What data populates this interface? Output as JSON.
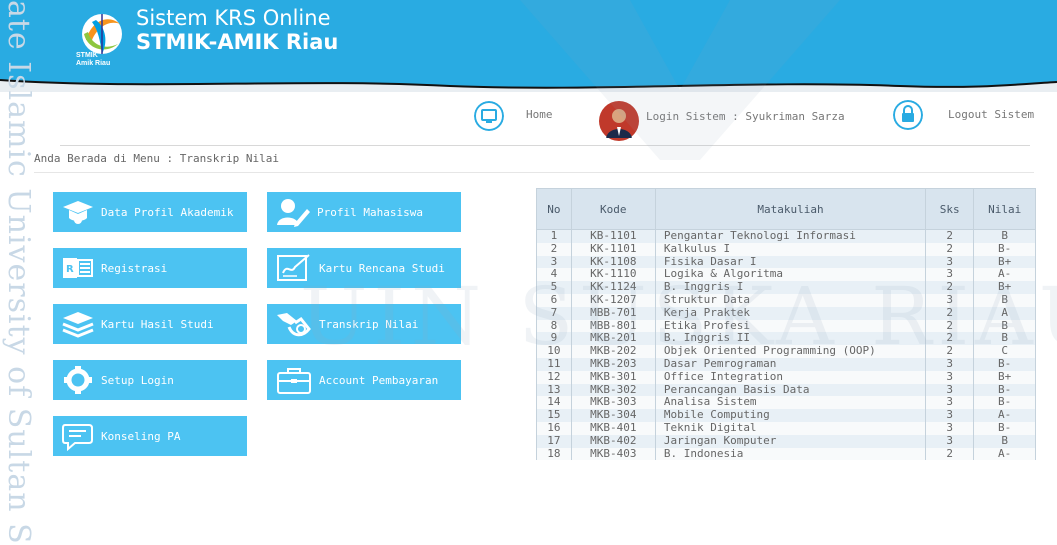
{
  "header": {
    "title_line1": "Sistem KRS Online",
    "title_line2": "STMIK-AMIK Riau",
    "logo_caption_line1": "STMIK",
    "logo_caption_line2": "Amik Riau"
  },
  "nav": {
    "home_label": "Home",
    "login_label": "Login Sistem : Syukriman Sarza",
    "logout_label": "Logout Sistem"
  },
  "breadcrumb": "Anda Berada di Menu : Transkrip Nilai",
  "menu": {
    "data_profil_akademik": "Data Profil Akademik",
    "profil_mahasiswa": "Profil Mahasiswa",
    "registrasi": "Registrasi",
    "kartu_rencana_studi": "Kartu Rencana Studi",
    "kartu_hasil_studi": "Kartu Hasil Studi",
    "transkrip_nilai": "Transkrip Nilai",
    "setup_login": "Setup Login",
    "account_pembayaran": "Account Pembayaran",
    "konseling_pa": "Konseling PA"
  },
  "table": {
    "headers": [
      "No",
      "Kode",
      "Matakuliah",
      "Sks",
      "Nilai"
    ],
    "rows": [
      [
        "1",
        "KB-1101",
        "Pengantar Teknologi Informasi",
        "2",
        "B"
      ],
      [
        "2",
        "KK-1101",
        "Kalkulus I",
        "2",
        "B-"
      ],
      [
        "3",
        "KK-1108",
        "Fisika Dasar I",
        "3",
        "B+"
      ],
      [
        "4",
        "KK-1110",
        "Logika & Algoritma",
        "3",
        "A-"
      ],
      [
        "5",
        "KK-1124",
        "B. Inggris I",
        "2",
        "B+"
      ],
      [
        "6",
        "KK-1207",
        "Struktur Data",
        "3",
        "B"
      ],
      [
        "7",
        "MBB-701",
        "Kerja Praktek",
        "2",
        "A"
      ],
      [
        "8",
        "MBB-801",
        "Etika Profesi",
        "2",
        "B"
      ],
      [
        "9",
        "MKB-201",
        "B. Inggris II",
        "2",
        "B"
      ],
      [
        "10",
        "MKB-202",
        "Objek Oriented Programming (OOP)",
        "2",
        "C"
      ],
      [
        "11",
        "MKB-203",
        "Dasar Pemrograman",
        "3",
        "B-"
      ],
      [
        "12",
        "MKB-301",
        "Office Integration",
        "3",
        "B+"
      ],
      [
        "13",
        "MKB-302",
        "Perancangan Basis Data",
        "3",
        "B-"
      ],
      [
        "14",
        "MKB-303",
        "Analisa Sistem",
        "3",
        "B-"
      ],
      [
        "15",
        "MKB-304",
        "Mobile Computing",
        "3",
        "A-"
      ],
      [
        "16",
        "MKB-401",
        "Teknik Digital",
        "3",
        "B-"
      ],
      [
        "17",
        "MKB-402",
        "Jaringan Komputer",
        "3",
        "B"
      ],
      [
        "18",
        "MKB-403",
        "B. Indonesia",
        "2",
        "A-"
      ]
    ]
  },
  "watermark": {
    "vertical": "ate Islamic University of Sultan S",
    "center": "UIN SUSKA RIAU"
  },
  "colors": {
    "header_blue": "#29abe2",
    "tile_blue": "#4cc3f2",
    "table_header": "#d8e4ee",
    "row_alt": "#e8f0f6"
  },
  "icons": [
    "graduation-cap-icon",
    "user-edit-icon",
    "word-doc-icon",
    "signature-icon",
    "books-icon",
    "handshake-icon",
    "gear-icon",
    "briefcase-icon",
    "chat-bubble-icon",
    "monitor-icon",
    "avatar",
    "lock-icon"
  ]
}
